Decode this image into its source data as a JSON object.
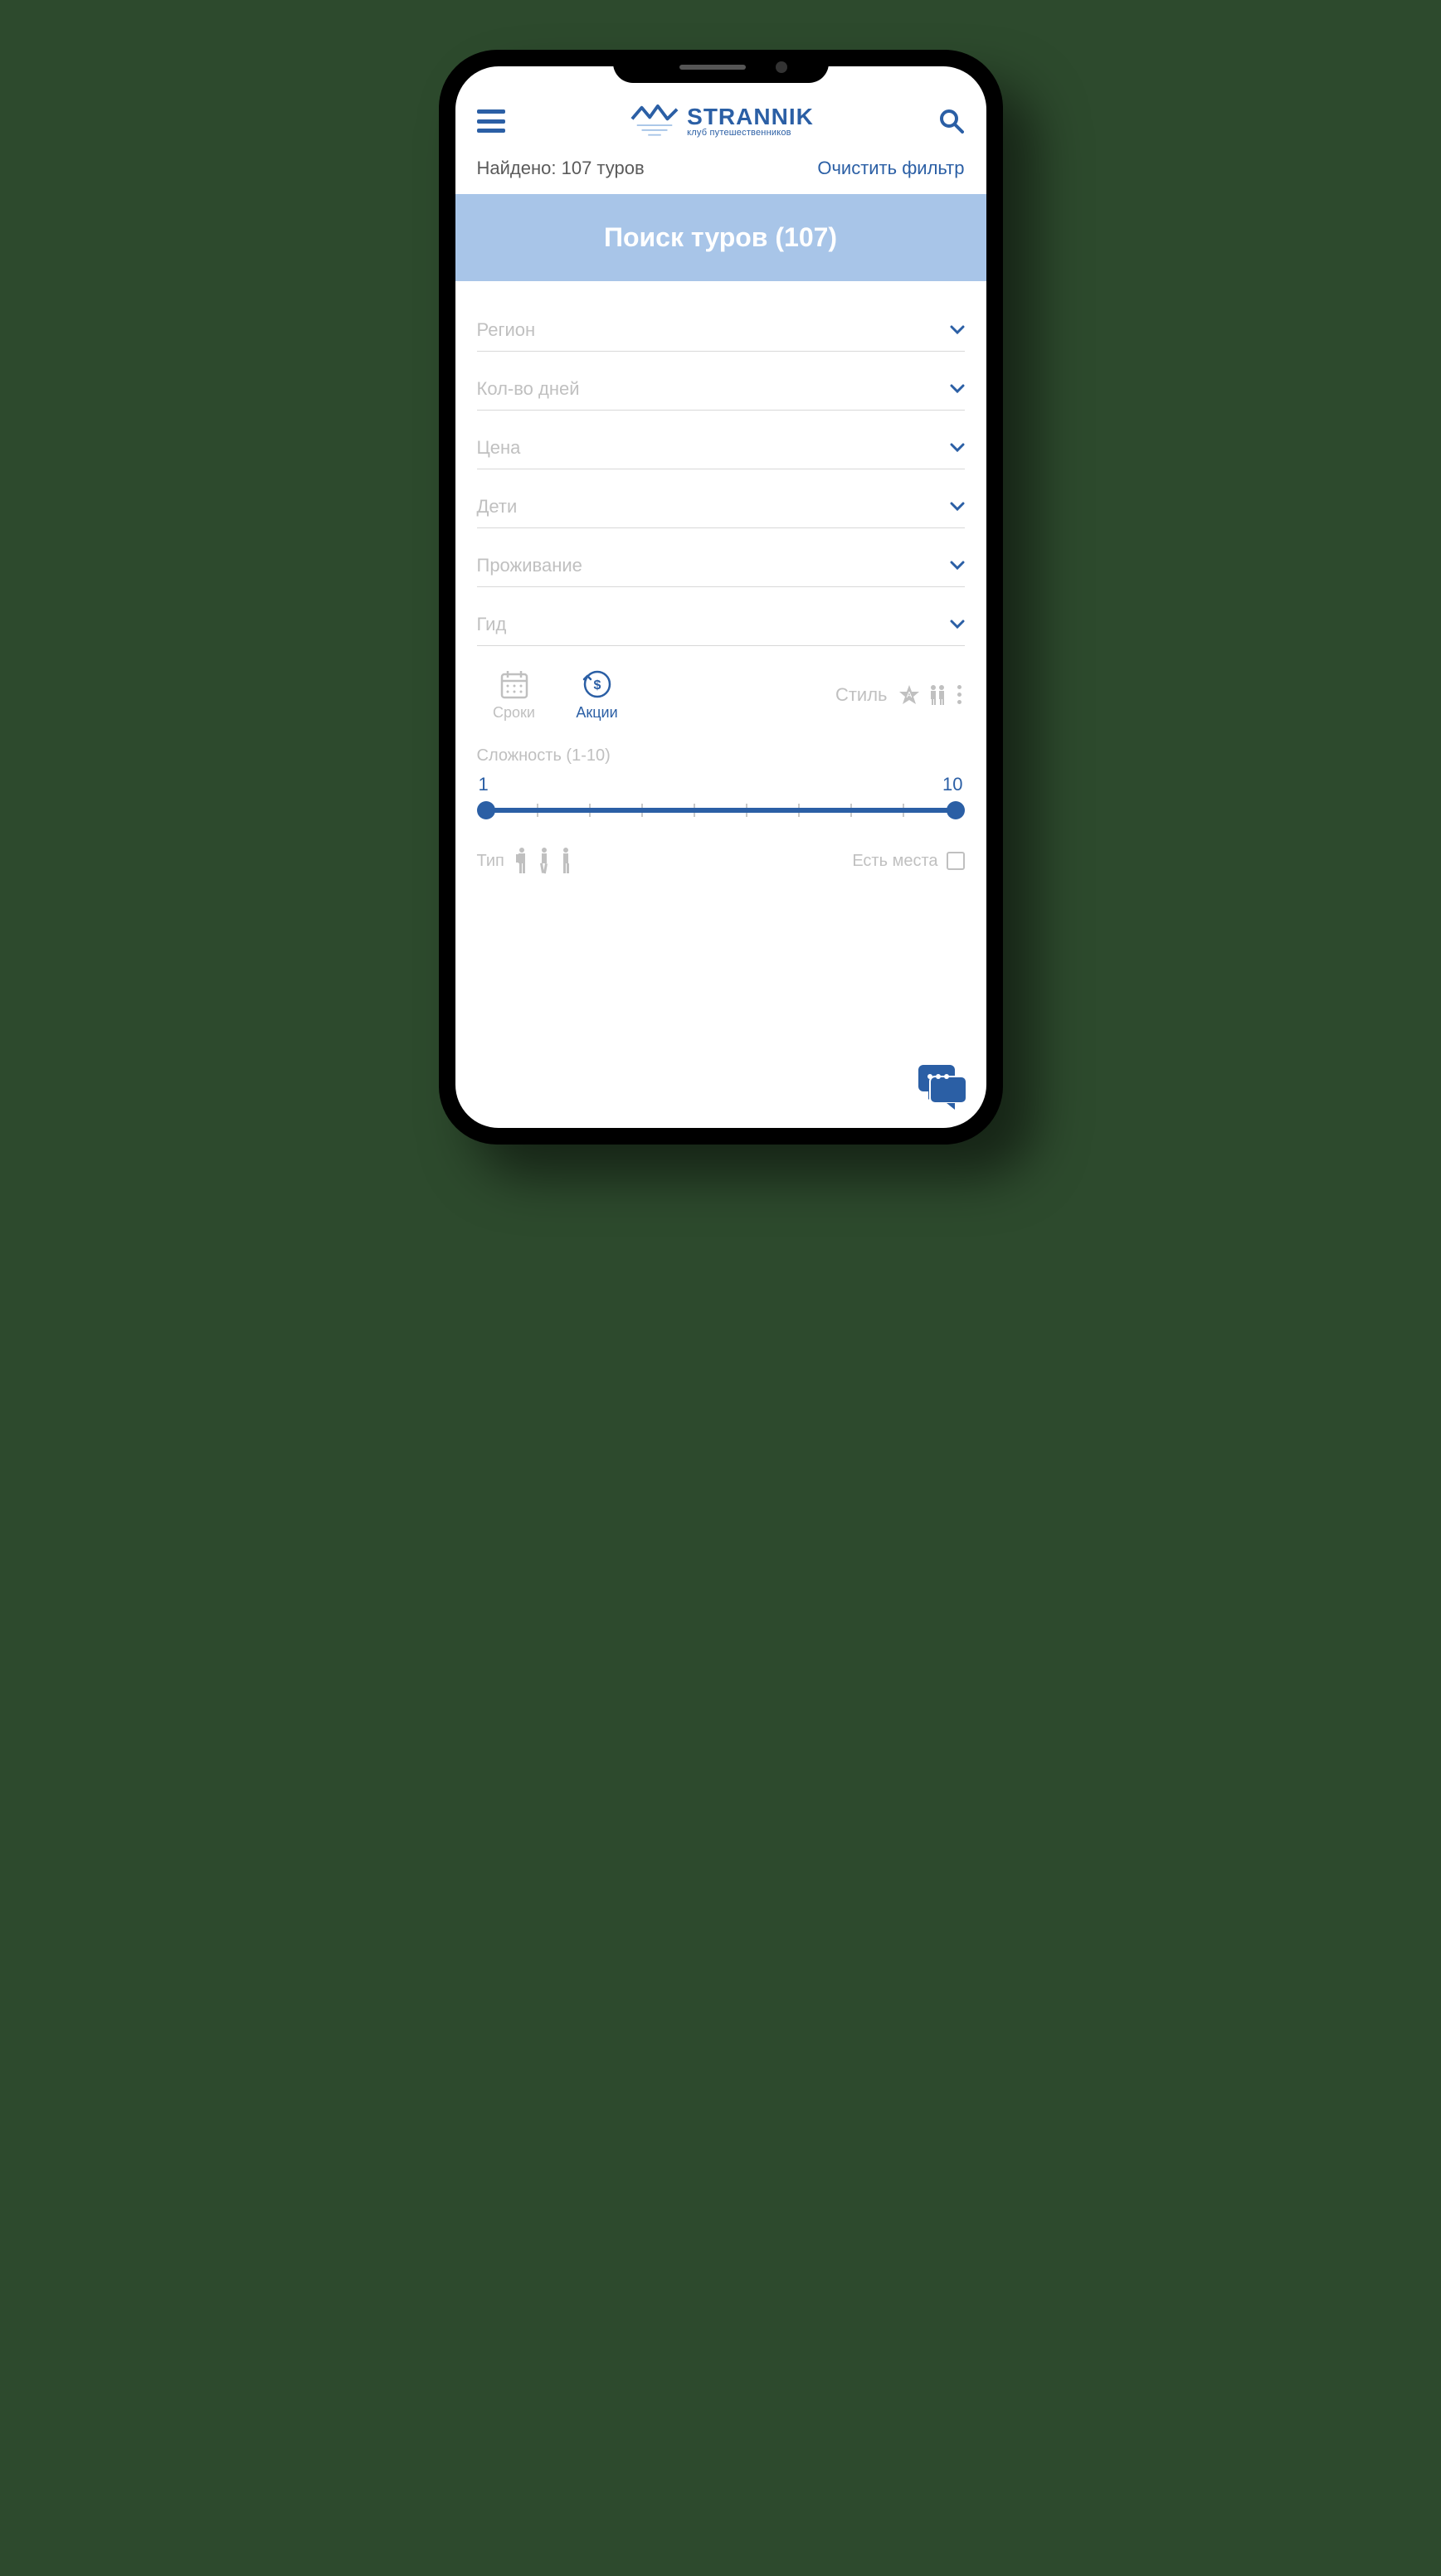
{
  "brand": {
    "name": "STRANNIK",
    "tagline": "клуб путешественников"
  },
  "results": {
    "label": "Найдено: 107 туров",
    "clear": "Очистить фильтр"
  },
  "banner": "Поиск туров (107)",
  "filters": [
    {
      "label": "Регион"
    },
    {
      "label": "Кол-во дней"
    },
    {
      "label": "Цена"
    },
    {
      "label": "Дети"
    },
    {
      "label": "Проживание"
    },
    {
      "label": "Гид"
    }
  ],
  "quick": {
    "dates": "Сроки",
    "promo": "Акции",
    "style": "Стиль"
  },
  "difficulty": {
    "label": "Сложность (1-10)",
    "min": "1",
    "max": "10"
  },
  "bottom": {
    "type": "Тип",
    "spots": "Есть места"
  }
}
